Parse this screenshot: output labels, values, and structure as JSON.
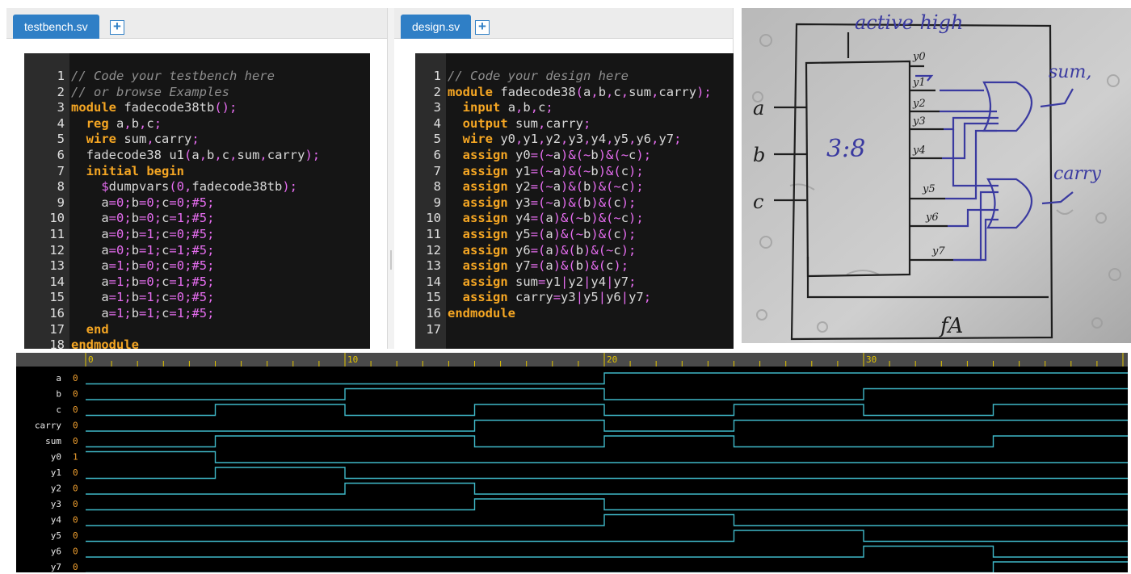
{
  "testbench": {
    "tab_label": "testbench.sv",
    "add_tab_label": "+",
    "lines": [
      {
        "n": "1",
        "code": "// Code your testbench here"
      },
      {
        "n": "2",
        "code": "// or browse Examples"
      },
      {
        "n": "3",
        "code": "module fadecode38tb();"
      },
      {
        "n": "4",
        "code": "  reg a,b,c;"
      },
      {
        "n": "5",
        "code": "  wire sum,carry;"
      },
      {
        "n": "6",
        "code": "  fadecode38 u1(a,b,c,sum,carry);"
      },
      {
        "n": "7",
        "code": "  initial begin"
      },
      {
        "n": "8",
        "code": "    $dumpvars(0,fadecode38tb);"
      },
      {
        "n": "9",
        "code": "    a=0;b=0;c=0;#5;"
      },
      {
        "n": "10",
        "code": "    a=0;b=0;c=1;#5;"
      },
      {
        "n": "11",
        "code": "    a=0;b=1;c=0;#5;"
      },
      {
        "n": "12",
        "code": "    a=0;b=1;c=1;#5;"
      },
      {
        "n": "13",
        "code": "    a=1;b=0;c=0;#5;"
      },
      {
        "n": "14",
        "code": "    a=1;b=0;c=1;#5;"
      },
      {
        "n": "15",
        "code": "    a=1;b=1;c=0;#5;"
      },
      {
        "n": "16",
        "code": "    a=1;b=1;c=1;#5;"
      },
      {
        "n": "17",
        "code": "  end"
      },
      {
        "n": "18",
        "code": "endmodule"
      }
    ]
  },
  "design": {
    "tab_label": "design.sv",
    "add_tab_label": "+",
    "lines": [
      {
        "n": "1",
        "code": "// Code your design here"
      },
      {
        "n": "2",
        "code": "module fadecode38(a,b,c,sum,carry);"
      },
      {
        "n": "3",
        "code": "  input a,b,c;"
      },
      {
        "n": "4",
        "code": "  output sum,carry;"
      },
      {
        "n": "5",
        "code": "  wire y0,y1,y2,y3,y4,y5,y6,y7;"
      },
      {
        "n": "6",
        "code": "  assign y0=(~a)&(~b)&(~c);"
      },
      {
        "n": "7",
        "code": "  assign y1=(~a)&(~b)&(c);"
      },
      {
        "n": "8",
        "code": "  assign y2=(~a)&(b)&(~c);"
      },
      {
        "n": "9",
        "code": "  assign y3=(~a)&(b)&(c);"
      },
      {
        "n": "10",
        "code": "  assign y4=(a)&(~b)&(~c);"
      },
      {
        "n": "11",
        "code": "  assign y5=(a)&(~b)&(c);"
      },
      {
        "n": "12",
        "code": "  assign y6=(a)&(b)&(~c);"
      },
      {
        "n": "13",
        "code": "  assign y7=(a)&(b)&(c);"
      },
      {
        "n": "14",
        "code": "  assign sum=y1|y2|y4|y7;"
      },
      {
        "n": "15",
        "code": "  assign carry=y3|y5|y6|y7;"
      },
      {
        "n": "16",
        "code": "endmodule"
      },
      {
        "n": "17",
        "code": ""
      }
    ]
  },
  "sketch": {
    "title": "active high",
    "decoder_label": "3:8",
    "inputs": [
      "a",
      "b",
      "c"
    ],
    "outputs": [
      "y0",
      "y1",
      "y2",
      "y3",
      "y4",
      "y5",
      "y6",
      "y7"
    ],
    "sum_label": "sum,",
    "carry_label": "carry",
    "footer": "fA"
  },
  "waveform": {
    "time_ticks": [
      "0",
      "10",
      "20",
      "30"
    ],
    "signals": [
      {
        "name": "a",
        "value": "0"
      },
      {
        "name": "b",
        "value": "0"
      },
      {
        "name": "c",
        "value": "0"
      },
      {
        "name": "carry",
        "value": "0"
      },
      {
        "name": "sum",
        "value": "0"
      },
      {
        "name": "y0",
        "value": "1"
      },
      {
        "name": "y1",
        "value": "0"
      },
      {
        "name": "y2",
        "value": "0"
      },
      {
        "name": "y3",
        "value": "0"
      },
      {
        "name": "y4",
        "value": "0"
      },
      {
        "name": "y5",
        "value": "0"
      },
      {
        "name": "y6",
        "value": "0"
      },
      {
        "name": "y7",
        "value": "0"
      }
    ],
    "colors": {
      "trace": "#3fb8c8",
      "tick": "#e3c400",
      "value": "#f0a030",
      "header": "#4a4a4a"
    }
  }
}
